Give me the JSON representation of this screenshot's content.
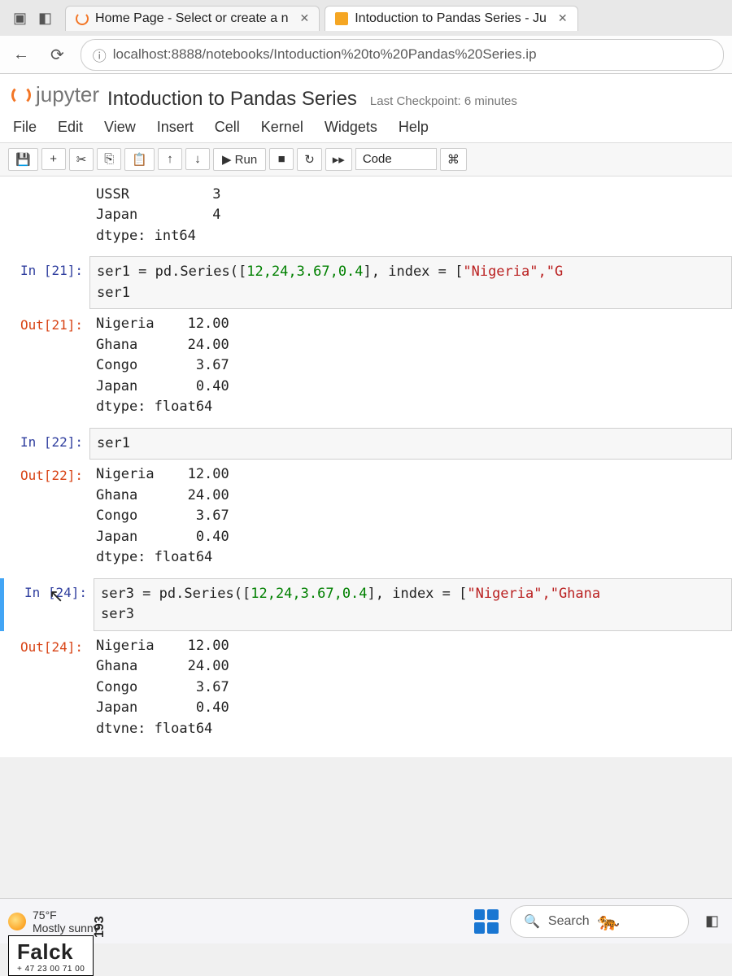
{
  "browser": {
    "tabs": [
      {
        "label": "Home Page - Select or create a n"
      },
      {
        "label": "Intoduction to Pandas Series - Ju"
      }
    ],
    "url": "localhost:8888/notebooks/Intoduction%20to%20Pandas%20Series.ip"
  },
  "jupyter": {
    "logo_text": "jupyter",
    "title": "Intoduction to Pandas Series",
    "checkpoint": "Last Checkpoint: 6 minutes",
    "menu": [
      "File",
      "Edit",
      "View",
      "Insert",
      "Cell",
      "Kernel",
      "Widgets",
      "Help"
    ],
    "toolbar": {
      "save": "💾",
      "add": "+",
      "cut": "✂",
      "copy": "⎘",
      "paste": "📋",
      "up": "↑",
      "down": "↓",
      "run": "▶ Run",
      "stop": "■",
      "restart": "↻",
      "ff": "▸▸",
      "celltype": "Code",
      "cmd": "⌘"
    }
  },
  "cells": {
    "top_out": "USSR          3\nJapan         4\ndtype: int64",
    "in21_prompt": "In [21]:",
    "in21_code_pre": "ser1 = pd.Series([",
    "in21_nums": "12,24,3.67,0.4",
    "in21_code_mid": "], index = [",
    "in21_strs": "\"Nigeria\",\"G",
    "in21_line2": "ser1",
    "out21_prompt": "Out[21]:",
    "out21": "Nigeria    12.00\nGhana      24.00\nCongo       3.67\nJapan       0.40\ndtype: float64",
    "in22_prompt": "In [22]:",
    "in22_code": "ser1",
    "out22_prompt": "Out[22]:",
    "out22": "Nigeria    12.00\nGhana      24.00\nCongo       3.67\nJapan       0.40\ndtype: float64",
    "in24_prompt": "In [24]:",
    "in24_code_pre": "ser3 = pd.Series([",
    "in24_nums": "12,24,3.67,0.4",
    "in24_code_mid": "], index = [",
    "in24_strs": "\"Nigeria\",\"Ghana",
    "in24_line2": "ser3",
    "out24_prompt": "Out[24]:",
    "out24": "Nigeria    12.00\nGhana      24.00\nCongo       3.67\nJapan       0.40\ndtvne: float64"
  },
  "taskbar": {
    "temp": "75°F",
    "cond": "Mostly sunny",
    "search": "Search"
  },
  "sticker": {
    "brand": "Falck",
    "phone": "+ 47 23 00 71 00",
    "side": "193"
  }
}
